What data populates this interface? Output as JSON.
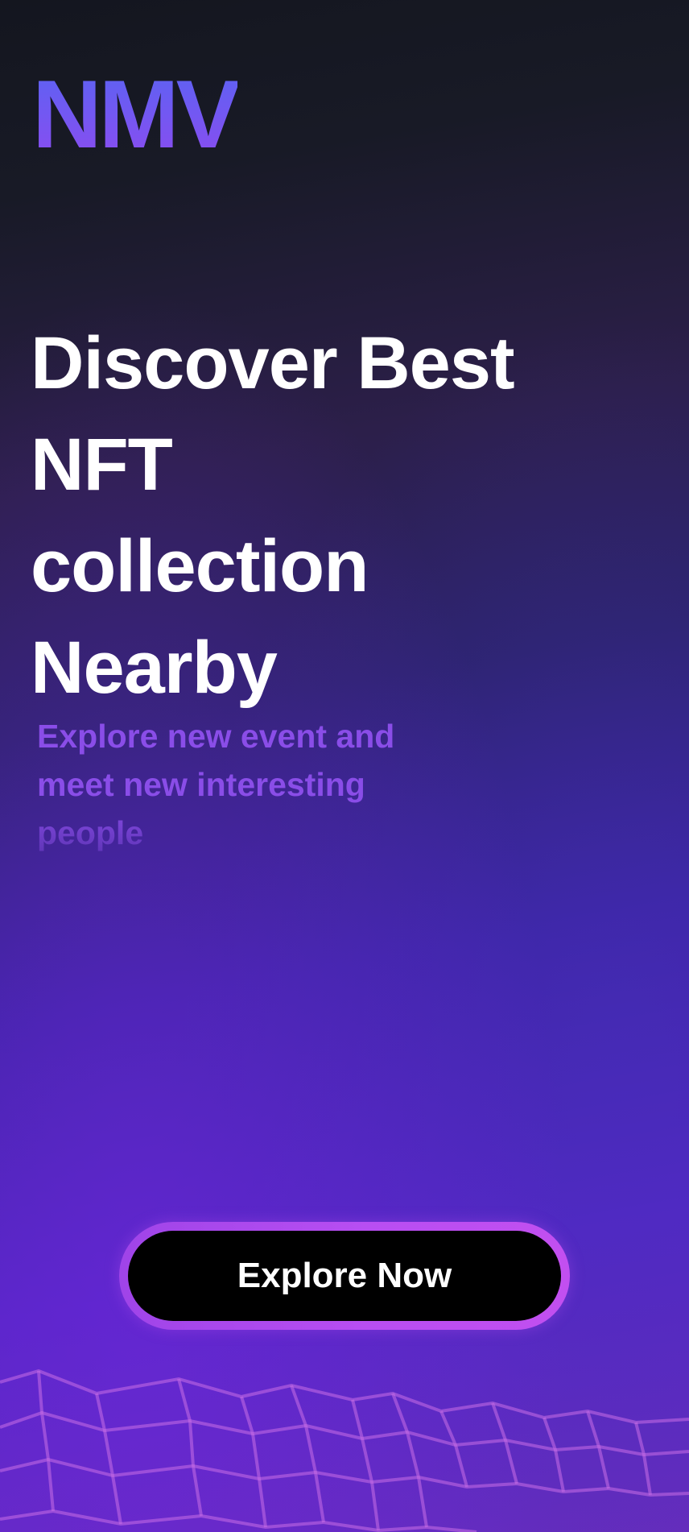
{
  "brand": {
    "logo_text": "NMV"
  },
  "hero": {
    "headline_lines": [
      "Discover Best",
      "NFT",
      "collection",
      "Nearby"
    ],
    "subtitle": "Explore new event and meet new interesting people"
  },
  "cta": {
    "label": "Explore Now"
  },
  "colors": {
    "logo_gradient": [
      "#5b63f3",
      "#8b4cf0"
    ],
    "subtitle": "#8a4de8",
    "button_ring": "#b84ef2",
    "button_fill": "#000000"
  }
}
